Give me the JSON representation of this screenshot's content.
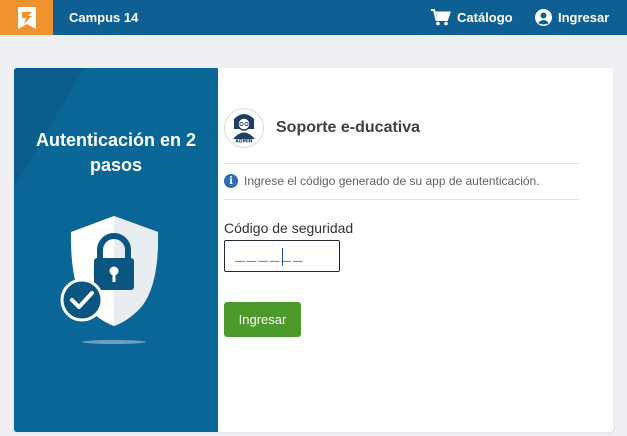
{
  "header": {
    "campus": "Campus 14",
    "catalog_label": "Catálogo",
    "login_label": "Ingresar",
    "logo_icon": "e-ducativa-logo-icon",
    "catalog_icon": "cart-icon",
    "login_icon": "user-circle-icon",
    "colors": {
      "bar": "#0e5f93",
      "logo_bg": "#f0922f"
    }
  },
  "left_panel": {
    "title": "Autenticación en 2 pasos",
    "illustration": "shield-lock-check-icon",
    "colors": {
      "bg": "#0b6698"
    }
  },
  "profile": {
    "name": "Soporte e-ducativa",
    "avatar_icon": "admin-avatar-icon",
    "avatar_caption": "ADMIN"
  },
  "info": {
    "icon": "info-icon",
    "text": "Ingrese el código generado de su app de autenticación."
  },
  "form": {
    "code_label": "Código de seguridad",
    "code_placeholder": "______",
    "code_value": "",
    "submit_label": "Ingresar",
    "colors": {
      "button": "#4c9a2a"
    }
  }
}
